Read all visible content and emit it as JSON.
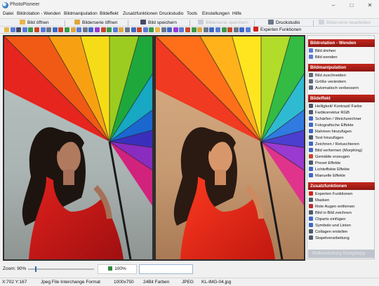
{
  "window": {
    "title": "PhotoPioneer",
    "minimize": "–",
    "maximize": "□",
    "close": "✕"
  },
  "menu": [
    "Datei",
    "Bildrotation - Wenden",
    "Bildmanipulation",
    "Bildeffekt",
    "Zusatzfunktionen",
    "Druckstudio",
    "Tools",
    "Einstellungen",
    "Hilfe"
  ],
  "toolbar": {
    "open": "Bild öffnen",
    "open_series": "Bilderserie öffnen",
    "save": "Bild speichern",
    "save_series": "Bilderserie speichern",
    "print": "Druckstudio",
    "expert": "Experten Funktionen",
    "series_processing": "Bilderserie bearbeiten"
  },
  "panel": {
    "rotation": {
      "title": "Bildrotation - Wenden",
      "items": [
        "Bild drehen",
        "Bild wenden"
      ]
    },
    "manipulation": {
      "title": "Bildmanipulation",
      "items": [
        "Bild zuschneiden",
        "Größe verändern",
        "Automatisch verbessern"
      ]
    },
    "effect": {
      "title": "Bildeffekt",
      "items": [
        "Helligkeit/ Kontrast/ Farbe",
        "Farbkorrektur RGB",
        "Schärfen / Weichzeichner",
        "Fotografische Effekte",
        "Rahmen hinzufügen",
        "Text hinzufügen",
        "Zeichnen / Retuschieren",
        "Bild verformen (Morphing)",
        "Gemälde erzeugen",
        "Preset Effekte",
        "Lichteffekte Effekte",
        "Manuelle Effekte"
      ]
    },
    "extra": {
      "title": "Zusatzfunktionen",
      "items": [
        "Experten Funktionen",
        "Masken",
        "Rote Augen entfernen",
        "Bild in Bild zeichnen",
        "Cliparts einfügen",
        "Symbole und Linien",
        "Collagen erstellen",
        "Stapelverarbeitung"
      ]
    },
    "footer": "Bildbearbeitung Rückgängig"
  },
  "zoom": {
    "label": "Zoom: 90%",
    "value": 90,
    "button": "100%"
  },
  "status": {
    "coords": "X:702 Y:167",
    "format": "Jpeg File Interchange Format",
    "size": "1000x750",
    "depth": "24Bit Farben",
    "type": "JPEG",
    "file": "KL-IMG-04.jpg"
  }
}
